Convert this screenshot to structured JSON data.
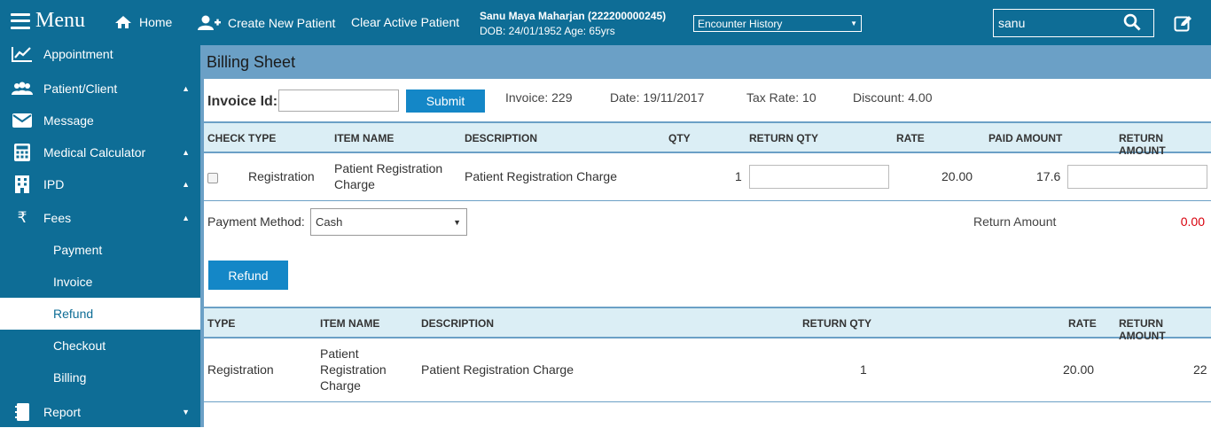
{
  "topbar": {
    "menu_label": "Menu",
    "home_label": "Home",
    "create_patient_label": "Create New Patient",
    "clear_patient_label": "Clear Active Patient",
    "patient_name": "Sanu Maya Maharjan (222200000245)",
    "patient_dob": "DOB: 24/01/1952 Age: 65yrs",
    "encounter_select": "Encounter History",
    "search_value": "sanu"
  },
  "sidebar": {
    "items": [
      {
        "label": "Appointment",
        "icon": "chart-line-icon"
      },
      {
        "label": "Patient/Client",
        "icon": "users-icon"
      },
      {
        "label": "Message",
        "icon": "envelope-icon"
      },
      {
        "label": "Medical Calculator",
        "icon": "calculator-icon"
      },
      {
        "label": "IPD",
        "icon": "building-icon"
      },
      {
        "label": "Fees",
        "icon": "rupee-icon"
      },
      {
        "label": "Report",
        "icon": "notebook-icon"
      }
    ],
    "fees_sub": [
      "Payment",
      "Invoice",
      "Refund",
      "Checkout",
      "Billing"
    ]
  },
  "main": {
    "title": "Billing Sheet",
    "invoice_label": "Invoice Id:",
    "submit_label": "Submit",
    "invoice": "Invoice: 229",
    "date": "Date: 19/11/2017",
    "tax_rate": "Tax Rate: 10",
    "discount": "Discount: 4.00"
  },
  "table1": {
    "headers": [
      "CHECK",
      "TYPE",
      "ITEM NAME",
      "DESCRIPTION",
      "QTY",
      "RETURN QTY",
      "RATE",
      "PAID AMOUNT",
      "RETURN AMOUNT"
    ],
    "row": {
      "type": "Registration",
      "item_name_line1": "Patient Registration",
      "item_name_line2": "Charge",
      "description": "Patient Registration Charge",
      "qty": "1",
      "rate": "20.00",
      "paid_amount": "17.6"
    }
  },
  "payment": {
    "label": "Payment Method:",
    "method": "Cash",
    "return_amount_label": "Return Amount",
    "return_amount_value": "0.00",
    "refund_label": "Refund"
  },
  "table2": {
    "headers": [
      "TYPE",
      "ITEM NAME",
      "DESCRIPTION",
      "RETURN QTY",
      "RATE",
      "RETURN AMOUNT"
    ],
    "row": {
      "type": "Registration",
      "item_name_line1": "Patient",
      "item_name_line2": "Registration",
      "item_name_line3": "Charge",
      "description": "Patient Registration Charge",
      "return_qty": "1",
      "rate": "20.00",
      "return_amount": "22"
    }
  }
}
